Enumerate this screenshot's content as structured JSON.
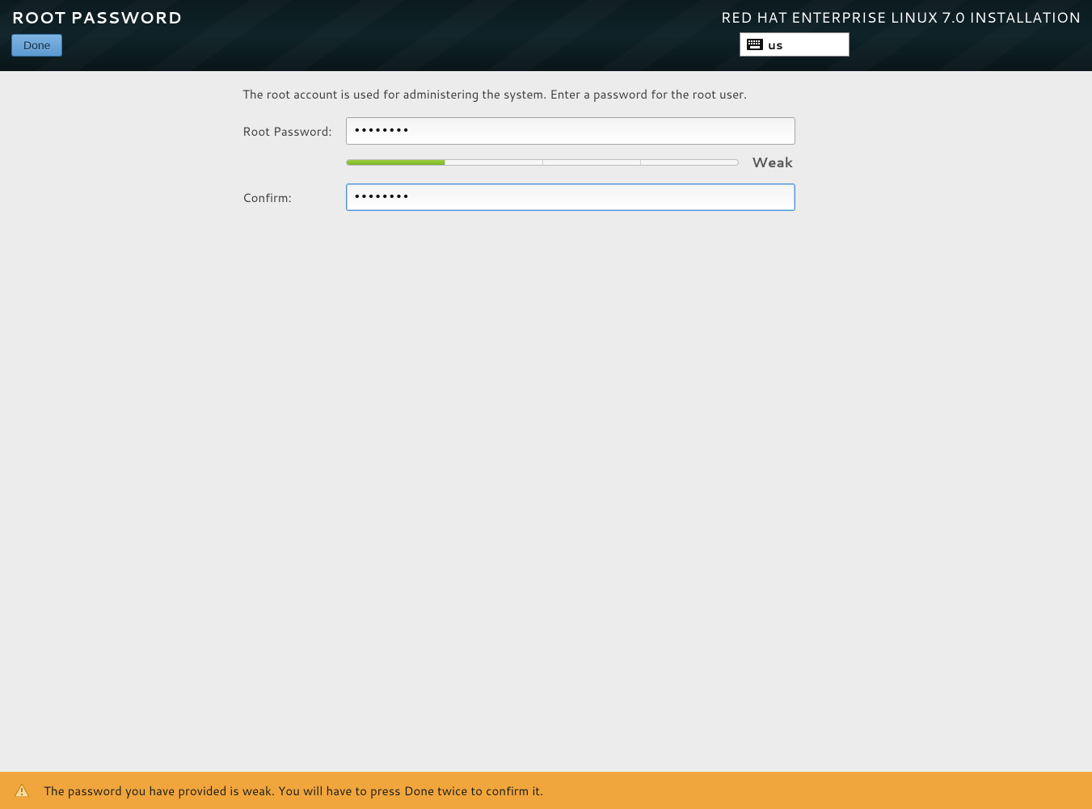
{
  "header": {
    "page_title": "ROOT PASSWORD",
    "done_label": "Done",
    "installer_title": "RED HAT ENTERPRISE LINUX 7.0 INSTALLATION",
    "keyboard_layout": "us"
  },
  "main": {
    "description": "The root account is used for administering the system.  Enter a password for the root user.",
    "root_password_label": "Root Password:",
    "root_password_value": "••••••••",
    "confirm_label": "Confirm:",
    "confirm_value": "••••••••",
    "strength_label": "Weak",
    "strength_percent": 25
  },
  "footer": {
    "message": "The password you have provided is weak. You will have to press Done twice to confirm it."
  }
}
